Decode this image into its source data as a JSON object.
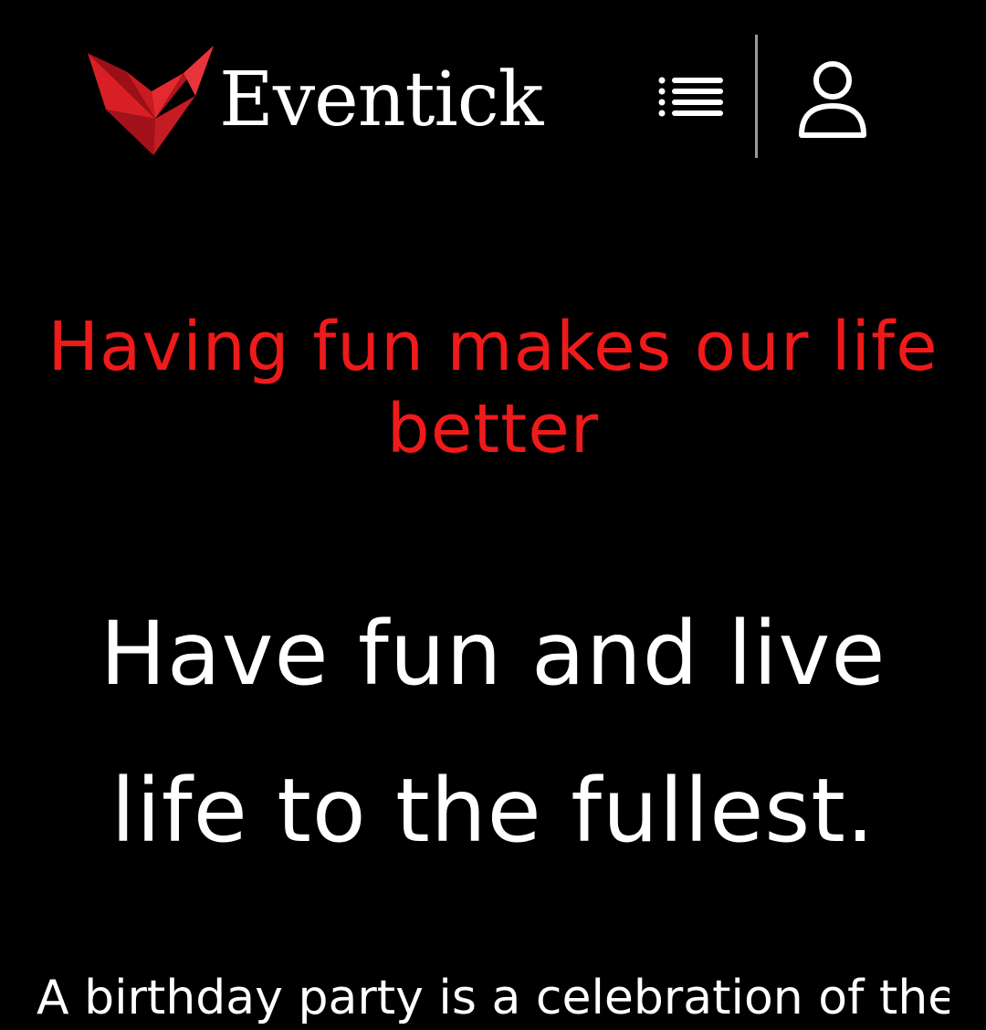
{
  "header": {
    "brand_name": "Eventick",
    "menu_icon": "list-menu-icon",
    "user_icon": "user-icon",
    "logo_icon": "red-v-logo-icon"
  },
  "hero": {
    "tagline": "Having fun makes our life better",
    "headline": "Have fun and live life to the fullest.",
    "body": "A birthday party is a celebration of the"
  },
  "colors": {
    "background": "#000000",
    "tagline": "#ef1a1a",
    "text": "#ffffff",
    "divider": "#9a9a9a",
    "logo_red": "#d91f26"
  }
}
